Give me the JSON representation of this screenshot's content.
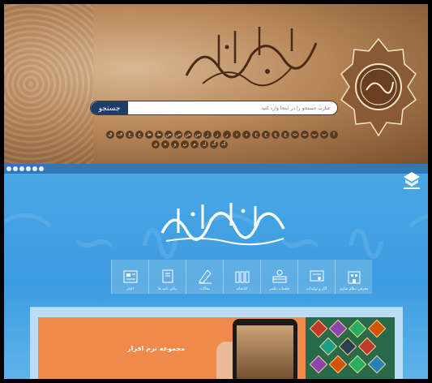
{
  "header": {
    "search_button": "جستجو",
    "search_placeholder": "عبارت جستجو را در اینجا وارد کنید",
    "letters_row1": [
      "ا",
      "ب",
      "پ",
      "ت",
      "ث",
      "ج",
      "چ",
      "ح",
      "خ",
      "د",
      "ذ",
      "ر",
      "ز",
      "ژ",
      "س",
      "ش",
      "ص",
      "ض",
      "ط",
      "ظ",
      "ع",
      "غ",
      "ف",
      "ق"
    ],
    "letters_row2": [
      "ک",
      "گ",
      "ل",
      "م",
      "ن",
      "و",
      "ه",
      "ی"
    ]
  },
  "blue": {
    "nav": [
      {
        "label": "معرفی نظام سازی",
        "icon": "building-icon"
      },
      {
        "label": "آثار و تولیدات",
        "icon": "certificate-icon"
      },
      {
        "label": "جلسات علمی",
        "icon": "meeting-icon"
      },
      {
        "label": "کتابخانه",
        "icon": "library-icon"
      },
      {
        "label": "مقالات",
        "icon": "article-icon"
      },
      {
        "label": "پایان نامه ها",
        "icon": "thesis-icon"
      },
      {
        "label": "اخبار",
        "icon": "news-icon"
      }
    ]
  },
  "promo": {
    "subtitle": "مجموعه نرم افزار"
  },
  "colors": {
    "banner": "#b8875a",
    "blue": "#3c9ce0",
    "search_button": "#1d3d6b",
    "promo": "#f08a4b"
  }
}
